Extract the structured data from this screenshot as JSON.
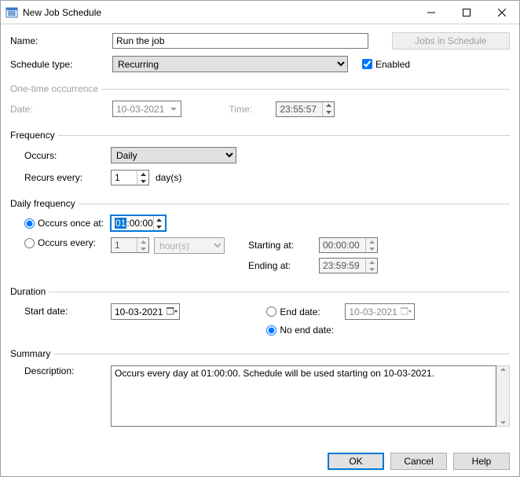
{
  "window": {
    "title": "New Job Schedule"
  },
  "win_btns": {
    "min": "minimize",
    "max": "maximize",
    "close": "close"
  },
  "top": {
    "name_label": "Name:",
    "name_value": "Run the job",
    "jobs_btn": "Jobs in Schedule",
    "type_label": "Schedule type:",
    "type_value": "Recurring",
    "enabled_label": "Enabled"
  },
  "onetime": {
    "legend": "One-time occurrence",
    "date_label": "Date:",
    "date_value": "10-03-2021",
    "time_label": "Time:",
    "time_value": "23:55:57"
  },
  "freq": {
    "legend": "Frequency",
    "occurs_label": "Occurs:",
    "occurs_value": "Daily",
    "recurs_label": "Recurs every:",
    "recurs_value": "1",
    "recurs_unit": "day(s)"
  },
  "daily": {
    "legend": "Daily frequency",
    "once_label": "Occurs once at:",
    "once_value_sel": "01",
    "once_value_rest": ":00:00",
    "every_label": "Occurs every:",
    "every_value": "1",
    "every_unit": "hour(s)",
    "start_label": "Starting at:",
    "start_value": "00:00:00",
    "end_label": "Ending at:",
    "end_value": "23:59:59"
  },
  "duration": {
    "legend": "Duration",
    "start_label": "Start date:",
    "start_value": "10-03-2021",
    "end_label": "End date:",
    "end_value": "10-03-2021",
    "noend_label": "No end date:"
  },
  "summary": {
    "legend": "Summary",
    "desc_label": "Description:",
    "desc_value": "Occurs every day at 01:00:00. Schedule will be used starting on 10-03-2021."
  },
  "footer": {
    "ok": "OK",
    "cancel": "Cancel",
    "help": "Help"
  }
}
